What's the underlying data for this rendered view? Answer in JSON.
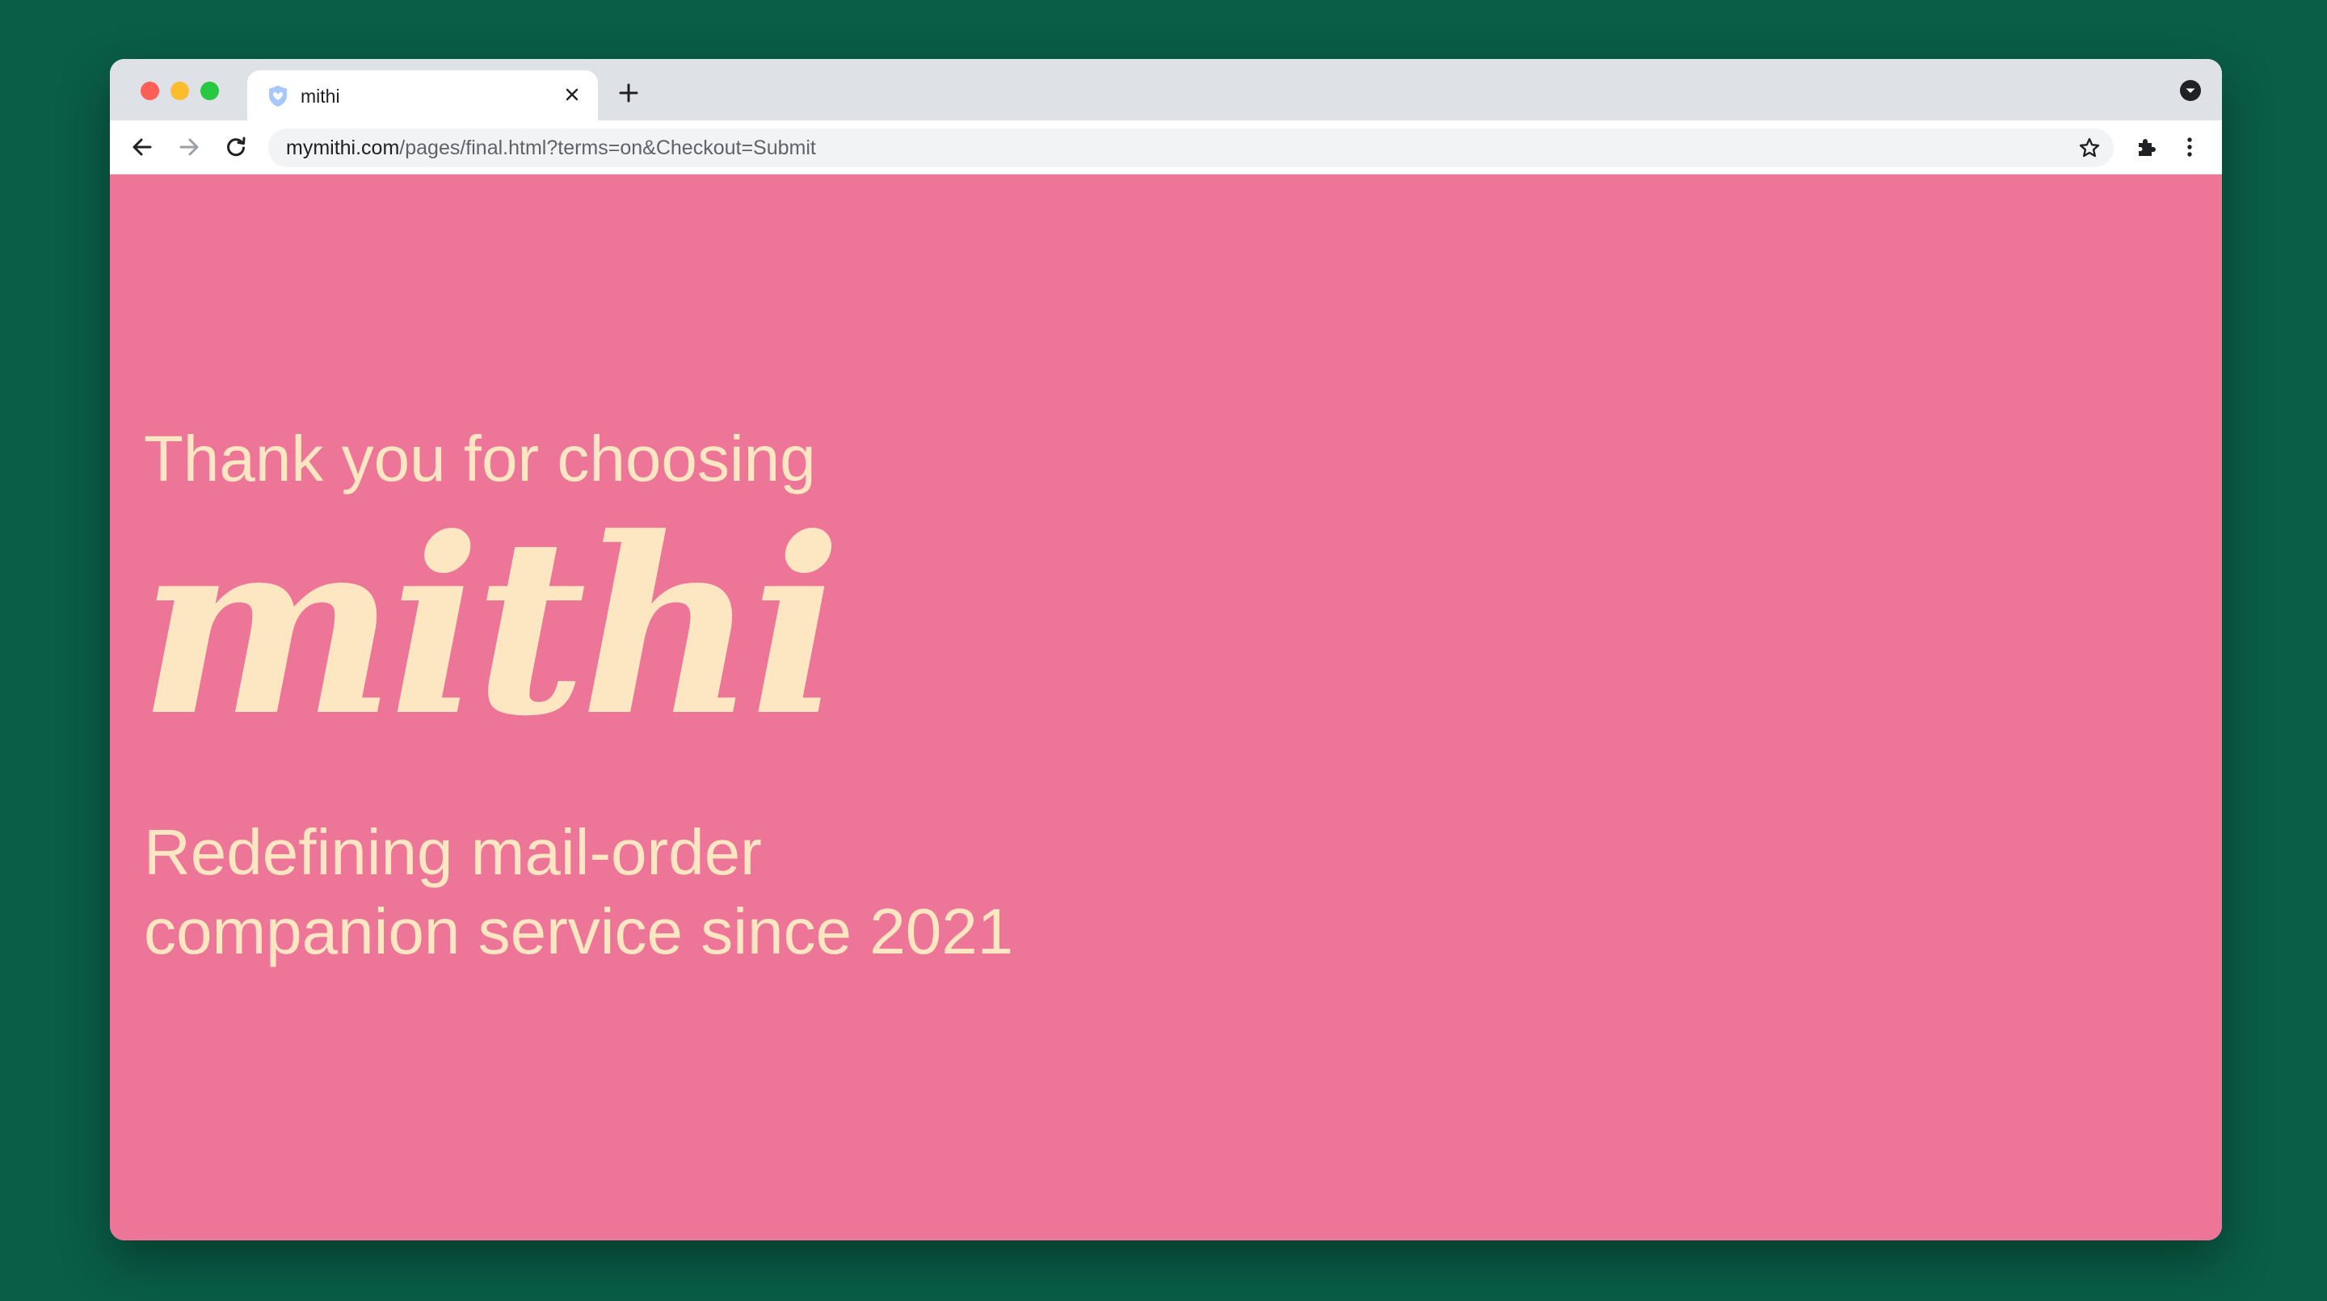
{
  "browser": {
    "tab": {
      "title": "mithi",
      "favicon_icon": "shield-heart-icon"
    },
    "url": {
      "host": "mymithi.com",
      "path": "/pages/final.html?terms=on&Checkout=Submit"
    },
    "icons": [
      "back-arrow-icon",
      "forward-arrow-icon",
      "reload-icon",
      "star-icon",
      "puzzle-icon",
      "kebab-menu-icon",
      "close-icon",
      "plus-icon",
      "tab-search-icon"
    ]
  },
  "page": {
    "heading": "Thank you for choosing",
    "brand": "mithi",
    "tagline_line1": "Redefining mail-order",
    "tagline_line2": "companion service since 2021"
  },
  "colors": {
    "desktop_bg": "#0a5d47",
    "page_bg": "#ec7598",
    "text": "#fde7c3"
  }
}
